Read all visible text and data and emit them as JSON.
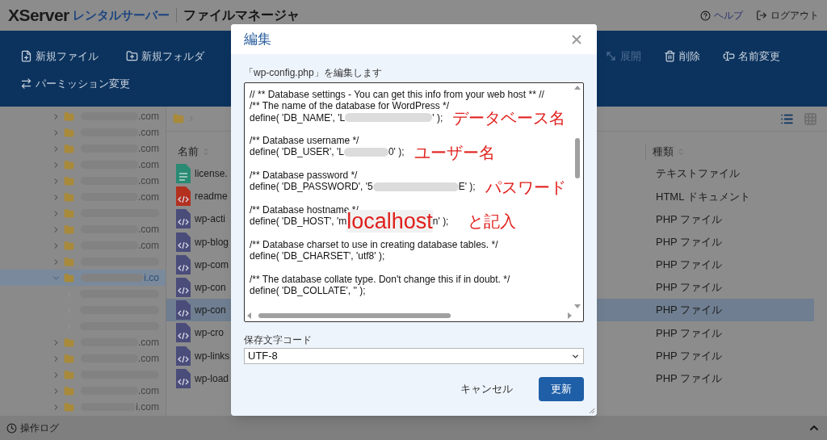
{
  "header": {
    "logo": "XServer",
    "logo_sub": "レンタルサーバー",
    "app_title": "ファイルマネージャ",
    "help": "ヘルプ",
    "logout": "ログアウト"
  },
  "toolbar": {
    "left": [
      {
        "kind": "new-file",
        "label": "新規ファイル",
        "disabled": false
      },
      {
        "kind": "new-folder",
        "label": "新規フォルダ",
        "disabled": false
      }
    ],
    "right": [
      {
        "kind": "extract",
        "label": "展開",
        "disabled": true
      },
      {
        "kind": "delete",
        "label": "削除",
        "disabled": false
      },
      {
        "kind": "rename",
        "label": "名前変更",
        "disabled": false
      }
    ],
    "row_2": [
      {
        "kind": "permission",
        "label": "パーミッション変更",
        "disabled": false
      }
    ]
  },
  "tree": [
    {
      "label": ".com",
      "expanded": false,
      "selected": false
    },
    {
      "label": ".com",
      "expanded": false,
      "selected": false
    },
    {
      "label": ".com",
      "expanded": false,
      "selected": false
    },
    {
      "label": ".com",
      "expanded": false,
      "selected": false
    },
    {
      "label": ".com",
      "expanded": false,
      "selected": false
    },
    {
      "label": ".com",
      "expanded": false,
      "selected": false
    },
    {
      "expanded": false,
      "selected": false
    },
    {
      "label": ".com",
      "expanded": false,
      "selected": false
    },
    {
      "label": ".com",
      "expanded": false,
      "selected": false
    },
    {
      "expanded": false,
      "selected": false
    },
    {
      "label": "i.co",
      "expanded": true,
      "selected": true,
      "children": [
        {
          "expanded": false,
          "selected": false
        },
        {
          "expanded": false,
          "selected": false
        },
        {
          "expanded": false,
          "selected": false
        }
      ]
    },
    {
      "label": ".com",
      "expanded": false,
      "selected": false
    },
    {
      "label": ".com",
      "expanded": false,
      "selected": false
    },
    {
      "expanded": false,
      "selected": false
    },
    {
      "label": ".com",
      "expanded": false,
      "selected": false
    },
    {
      "label": "i.com",
      "expanded": false,
      "selected": false
    }
  ],
  "view_modes": [
    {
      "kind": "list",
      "selected": true
    },
    {
      "kind": "grid",
      "selected": false
    }
  ],
  "file_list": {
    "columns": [
      "名前",
      "種類"
    ],
    "rows": [
      {
        "kind": "text",
        "name": "license.",
        "type": "テキストファイル",
        "selected": false
      },
      {
        "kind": "html",
        "name": "readme",
        "type": "HTML ドキュメント",
        "selected": false
      },
      {
        "kind": "php",
        "name": "wp-acti",
        "type": "PHP ファイル",
        "selected": false
      },
      {
        "kind": "php",
        "name": "wp-blog",
        "type": "PHP ファイル",
        "selected": false
      },
      {
        "kind": "php",
        "name": "wp-com",
        "type": "PHP ファイル",
        "selected": false
      },
      {
        "kind": "php",
        "name": "wp-con",
        "type": "PHP ファイル",
        "selected": false
      },
      {
        "kind": "php",
        "name": "wp-con",
        "type": "PHP ファイル",
        "selected": true
      },
      {
        "kind": "php",
        "name": "wp-cro",
        "type": "PHP ファイル",
        "selected": false
      },
      {
        "kind": "php",
        "name": "wp-links",
        "type": "PHP ファイル",
        "selected": false
      },
      {
        "kind": "php",
        "name": "wp-load",
        "type": "PHP ファイル",
        "selected": false
      }
    ]
  },
  "status_bar": {
    "label": "操作ログ"
  },
  "dialog": {
    "title": "編集",
    "description": "「wp-config.php」を編集します",
    "code_lines": [
      {
        "kind": "text",
        "text": "// ** Database settings - You can get this info from your web host ** //"
      },
      {
        "kind": "text",
        "text": "/** The name of the database for WordPress */"
      },
      {
        "kind": "define",
        "prefix": "define( 'DB_NAME', 'L",
        "suffix": "' );",
        "annotation": "データベース名"
      },
      {
        "kind": "blank"
      },
      {
        "kind": "text",
        "text": "/** Database username */"
      },
      {
        "kind": "define",
        "prefix": "define( 'DB_USER', 'L",
        "suffix": "0' );",
        "annotation": "ユーザー名"
      },
      {
        "kind": "blank"
      },
      {
        "kind": "text",
        "text": "/** Database password */"
      },
      {
        "kind": "define",
        "prefix": "define( 'DB_PASSWORD', '5",
        "suffix": "E' );",
        "annotation": "パスワード"
      },
      {
        "kind": "blank"
      },
      {
        "kind": "text",
        "text": "/** Database hostname */"
      },
      {
        "kind": "define",
        "prefix": "define( 'DB_HOST', 'm",
        "overlay": "localhost",
        "suffix": "n' );",
        "annotation": "と記入"
      },
      {
        "kind": "blank"
      },
      {
        "kind": "text",
        "text": "/** Database charset to use in creating database tables. */"
      },
      {
        "kind": "text",
        "text": "define( 'DB_CHARSET', 'utf8' );"
      },
      {
        "kind": "blank"
      },
      {
        "kind": "text",
        "text": "/** The database collate type. Don't change this if in doubt. */"
      },
      {
        "kind": "text",
        "text": "define( 'DB_COLLATE', '' );"
      }
    ],
    "encoding_label": "保存文字コード",
    "encoding_value": "UTF-8",
    "cancel": "キャンセル",
    "submit": "更新"
  }
}
